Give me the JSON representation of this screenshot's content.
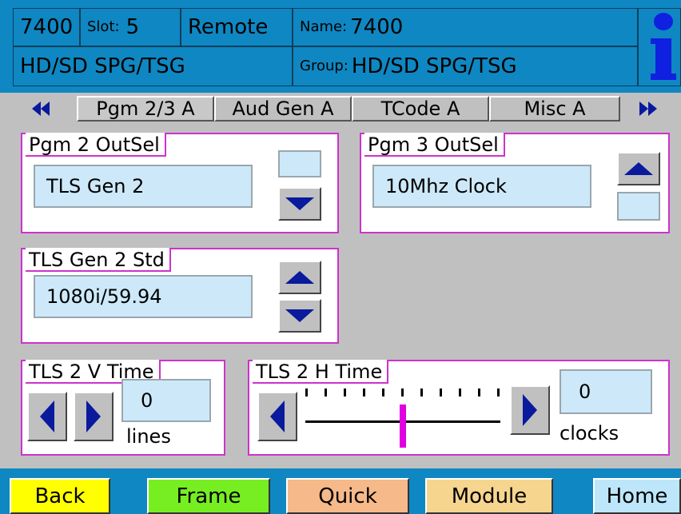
{
  "header": {
    "model": "7400",
    "slot_label": "Slot:",
    "slot_value": "5",
    "mode": "Remote",
    "name_label": "Name:",
    "name_value": "7400",
    "card_type": "HD/SD SPG/TSG",
    "group_label": "Group:",
    "group_value": "HD/SD SPG/TSG",
    "info_icon": "info-icon"
  },
  "tabs": {
    "prev_icon": "double-left-arrow-icon",
    "next_icon": "double-right-arrow-icon",
    "items": [
      {
        "label": "Pgm 2/3 A",
        "active": true
      },
      {
        "label": "Aud Gen A",
        "active": false
      },
      {
        "label": "TCode A",
        "active": false
      },
      {
        "label": "Misc A",
        "active": false
      }
    ]
  },
  "pgm2": {
    "title": "Pgm 2 OutSel",
    "value": "TLS Gen 2"
  },
  "pgm3": {
    "title": "Pgm 3 OutSel",
    "value": "10Mhz Clock"
  },
  "tls_std": {
    "title": "TLS Gen 2 Std",
    "value": "1080i/59.94"
  },
  "v_time": {
    "title": "TLS 2 V Time",
    "value": "0",
    "unit": "lines"
  },
  "h_time": {
    "title": "TLS 2 H Time",
    "value": "0",
    "unit": "clocks",
    "slider_position": 0.5
  },
  "footer": {
    "back": "Back",
    "frame": "Frame",
    "quick": "Quick",
    "module": "Module",
    "home": "Home"
  },
  "colors": {
    "header_bg": "#0f87c2",
    "panel_border": "#cc33cc",
    "value_bg": "#cde9f9",
    "arrow": "#0a1a9c",
    "back": "#ffff00",
    "frame": "#77ee22",
    "quick": "#f6b98a",
    "module": "#f6d58e",
    "home": "#bde6fb"
  }
}
